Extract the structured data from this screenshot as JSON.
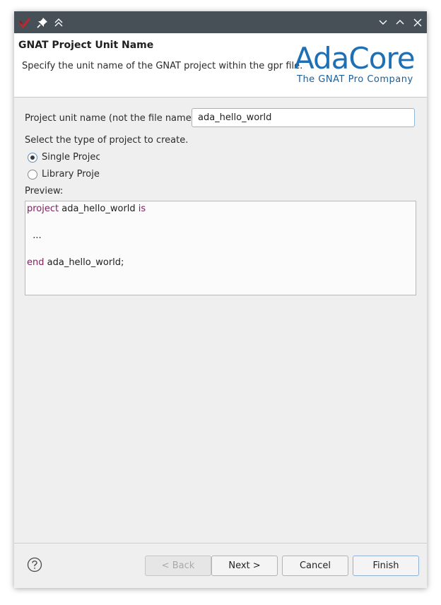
{
  "titlebar": {
    "app_icon": "eclipse-gnat-icon",
    "pin_icon": "pin-icon",
    "keep_above_icon": "double-chevron-up-icon",
    "minimize_icon": "chevron-down-icon",
    "maximize_icon": "chevron-up-icon",
    "close_icon": "close-icon"
  },
  "banner": {
    "title": "GNAT Project Unit Name",
    "description": "Specify the unit name of the GNAT project within the gpr file.",
    "logo_main": "AdaCore",
    "logo_tagline": "The GNAT Pro Company"
  },
  "form": {
    "unit_name_label": "Project unit name (not the file name):",
    "unit_name_value": "ada_hello_world",
    "type_label": "Select the type of project to create.",
    "single_project_label": "Single Project",
    "library_project_label": "Library Project",
    "selected_type": "single",
    "preview_label": "Preview:"
  },
  "preview": {
    "line1_kw": "project",
    "line1_name": " ada_hello_world ",
    "line1_kw2": "is",
    "line2": "  ...",
    "line3_kw": "end",
    "line3_rest": " ada_hello_world;"
  },
  "buttons": {
    "help_icon": "help-icon",
    "back": "< Back",
    "next": "Next >",
    "cancel": "Cancel",
    "finish": "Finish"
  },
  "colors": {
    "titlebar": "#475057",
    "keyword": "#7b1f5e",
    "logo_blue": "#1f6fb4"
  }
}
